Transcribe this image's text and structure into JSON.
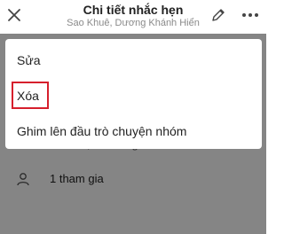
{
  "header": {
    "title": "Chi tiết nhắc hẹn",
    "subtitle": "Sao Khuê, Dương Khánh Hiển"
  },
  "details": {
    "date_text": "Thứ 10, 20 tháng 12 lúc 12:00",
    "participants": "1 tham gia"
  },
  "menu": {
    "items": [
      {
        "label": "Sửa"
      },
      {
        "label": "Xóa"
      },
      {
        "label": "Ghim lên đầu trò chuyện nhóm"
      }
    ]
  },
  "colors": {
    "highlight": "#d61f2c",
    "overlay": "rgba(0,0,0,0.48)"
  },
  "icons": [
    "close-icon",
    "edit-icon",
    "more-icon",
    "person-icon"
  ]
}
